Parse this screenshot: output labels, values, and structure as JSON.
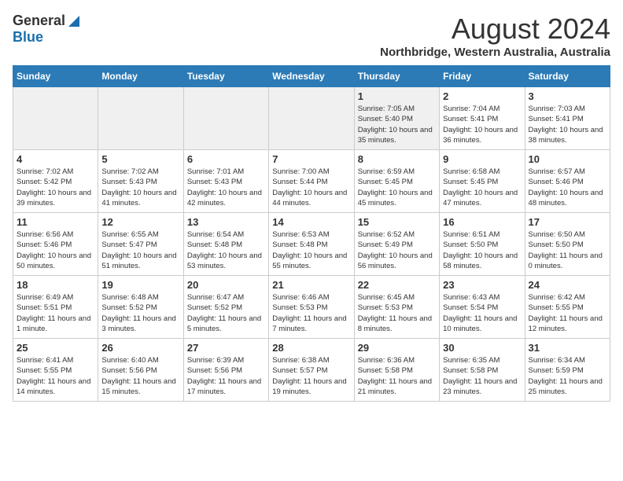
{
  "header": {
    "logo_general": "General",
    "logo_blue": "Blue",
    "month_title": "August 2024",
    "location": "Northbridge, Western Australia, Australia"
  },
  "days_of_week": [
    "Sunday",
    "Monday",
    "Tuesday",
    "Wednesday",
    "Thursday",
    "Friday",
    "Saturday"
  ],
  "weeks": [
    [
      {
        "day": "",
        "empty": true
      },
      {
        "day": "",
        "empty": true
      },
      {
        "day": "",
        "empty": true
      },
      {
        "day": "",
        "empty": true
      },
      {
        "day": "1",
        "sunrise": "7:05 AM",
        "sunset": "5:40 PM",
        "daylight": "10 hours and 35 minutes."
      },
      {
        "day": "2",
        "sunrise": "7:04 AM",
        "sunset": "5:41 PM",
        "daylight": "10 hours and 36 minutes."
      },
      {
        "day": "3",
        "sunrise": "7:03 AM",
        "sunset": "5:41 PM",
        "daylight": "10 hours and 38 minutes."
      }
    ],
    [
      {
        "day": "4",
        "sunrise": "7:02 AM",
        "sunset": "5:42 PM",
        "daylight": "10 hours and 39 minutes."
      },
      {
        "day": "5",
        "sunrise": "7:02 AM",
        "sunset": "5:43 PM",
        "daylight": "10 hours and 41 minutes."
      },
      {
        "day": "6",
        "sunrise": "7:01 AM",
        "sunset": "5:43 PM",
        "daylight": "10 hours and 42 minutes."
      },
      {
        "day": "7",
        "sunrise": "7:00 AM",
        "sunset": "5:44 PM",
        "daylight": "10 hours and 44 minutes."
      },
      {
        "day": "8",
        "sunrise": "6:59 AM",
        "sunset": "5:45 PM",
        "daylight": "10 hours and 45 minutes."
      },
      {
        "day": "9",
        "sunrise": "6:58 AM",
        "sunset": "5:45 PM",
        "daylight": "10 hours and 47 minutes."
      },
      {
        "day": "10",
        "sunrise": "6:57 AM",
        "sunset": "5:46 PM",
        "daylight": "10 hours and 48 minutes."
      }
    ],
    [
      {
        "day": "11",
        "sunrise": "6:56 AM",
        "sunset": "5:46 PM",
        "daylight": "10 hours and 50 minutes."
      },
      {
        "day": "12",
        "sunrise": "6:55 AM",
        "sunset": "5:47 PM",
        "daylight": "10 hours and 51 minutes."
      },
      {
        "day": "13",
        "sunrise": "6:54 AM",
        "sunset": "5:48 PM",
        "daylight": "10 hours and 53 minutes."
      },
      {
        "day": "14",
        "sunrise": "6:53 AM",
        "sunset": "5:48 PM",
        "daylight": "10 hours and 55 minutes."
      },
      {
        "day": "15",
        "sunrise": "6:52 AM",
        "sunset": "5:49 PM",
        "daylight": "10 hours and 56 minutes."
      },
      {
        "day": "16",
        "sunrise": "6:51 AM",
        "sunset": "5:50 PM",
        "daylight": "10 hours and 58 minutes."
      },
      {
        "day": "17",
        "sunrise": "6:50 AM",
        "sunset": "5:50 PM",
        "daylight": "11 hours and 0 minutes."
      }
    ],
    [
      {
        "day": "18",
        "sunrise": "6:49 AM",
        "sunset": "5:51 PM",
        "daylight": "11 hours and 1 minute."
      },
      {
        "day": "19",
        "sunrise": "6:48 AM",
        "sunset": "5:52 PM",
        "daylight": "11 hours and 3 minutes."
      },
      {
        "day": "20",
        "sunrise": "6:47 AM",
        "sunset": "5:52 PM",
        "daylight": "11 hours and 5 minutes."
      },
      {
        "day": "21",
        "sunrise": "6:46 AM",
        "sunset": "5:53 PM",
        "daylight": "11 hours and 7 minutes."
      },
      {
        "day": "22",
        "sunrise": "6:45 AM",
        "sunset": "5:53 PM",
        "daylight": "11 hours and 8 minutes."
      },
      {
        "day": "23",
        "sunrise": "6:43 AM",
        "sunset": "5:54 PM",
        "daylight": "11 hours and 10 minutes."
      },
      {
        "day": "24",
        "sunrise": "6:42 AM",
        "sunset": "5:55 PM",
        "daylight": "11 hours and 12 minutes."
      }
    ],
    [
      {
        "day": "25",
        "sunrise": "6:41 AM",
        "sunset": "5:55 PM",
        "daylight": "11 hours and 14 minutes."
      },
      {
        "day": "26",
        "sunrise": "6:40 AM",
        "sunset": "5:56 PM",
        "daylight": "11 hours and 15 minutes."
      },
      {
        "day": "27",
        "sunrise": "6:39 AM",
        "sunset": "5:56 PM",
        "daylight": "11 hours and 17 minutes."
      },
      {
        "day": "28",
        "sunrise": "6:38 AM",
        "sunset": "5:57 PM",
        "daylight": "11 hours and 19 minutes."
      },
      {
        "day": "29",
        "sunrise": "6:36 AM",
        "sunset": "5:58 PM",
        "daylight": "11 hours and 21 minutes."
      },
      {
        "day": "30",
        "sunrise": "6:35 AM",
        "sunset": "5:58 PM",
        "daylight": "11 hours and 23 minutes."
      },
      {
        "day": "31",
        "sunrise": "6:34 AM",
        "sunset": "5:59 PM",
        "daylight": "11 hours and 25 minutes."
      }
    ]
  ],
  "labels": {
    "sunrise": "Sunrise:",
    "sunset": "Sunset:",
    "daylight": "Daylight:"
  }
}
